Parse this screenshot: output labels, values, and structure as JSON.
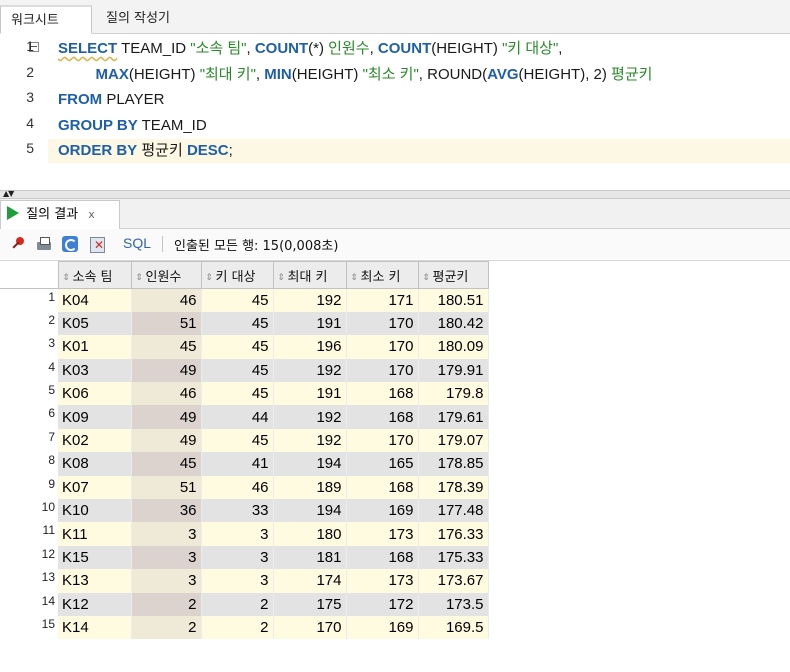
{
  "tabs": {
    "worksheet": "워크시트",
    "query_builder": "질의 작성기"
  },
  "editor": {
    "line_numbers": [
      "1",
      "2",
      "3",
      "4",
      "5"
    ],
    "lines": [
      [
        {
          "t": "SELECT",
          "c": "kw squig"
        },
        {
          "t": " TEAM_ID ",
          "c": ""
        },
        {
          "t": "\"소속 팀\"",
          "c": "str"
        },
        {
          "t": ", ",
          "c": ""
        },
        {
          "t": "COUNT",
          "c": "fn"
        },
        {
          "t": "(*) ",
          "c": ""
        },
        {
          "t": "인원수",
          "c": "str"
        },
        {
          "t": ", ",
          "c": ""
        },
        {
          "t": "COUNT",
          "c": "fn"
        },
        {
          "t": "(HEIGHT) ",
          "c": ""
        },
        {
          "t": "\"키 대상\"",
          "c": "str"
        },
        {
          "t": ",",
          "c": ""
        }
      ],
      [
        {
          "t": "         ",
          "c": ""
        },
        {
          "t": "MAX",
          "c": "fn"
        },
        {
          "t": "(HEIGHT) ",
          "c": ""
        },
        {
          "t": "\"최대 키\"",
          "c": "str"
        },
        {
          "t": ", ",
          "c": ""
        },
        {
          "t": "MIN",
          "c": "fn"
        },
        {
          "t": "(HEIGHT) ",
          "c": ""
        },
        {
          "t": "\"최소 키\"",
          "c": "str"
        },
        {
          "t": ", ROUND(",
          "c": ""
        },
        {
          "t": "AVG",
          "c": "fn"
        },
        {
          "t": "(HEIGHT), 2) ",
          "c": ""
        },
        {
          "t": "평균키",
          "c": "str"
        }
      ],
      [
        {
          "t": "FROM",
          "c": "kw"
        },
        {
          "t": " PLAYER",
          "c": ""
        }
      ],
      [
        {
          "t": "GROUP BY",
          "c": "kw"
        },
        {
          "t": " TEAM_ID",
          "c": ""
        }
      ],
      [
        {
          "t": "ORDER BY",
          "c": "kw"
        },
        {
          "t": " 평균키 ",
          "c": ""
        },
        {
          "t": "DESC",
          "c": "kw"
        },
        {
          "t": ";",
          "c": ""
        }
      ]
    ]
  },
  "results_tab": {
    "label": "질의 결과",
    "close": "x"
  },
  "toolbar": {
    "sql_label": "SQL",
    "status": "인출된 모든 행: 15(0,008초)"
  },
  "grid": {
    "columns": [
      "소속 팀",
      "인원수",
      "키 대상",
      "최대 키",
      "최소 키",
      "평균키"
    ],
    "rows": [
      [
        "K04",
        "46",
        "45",
        "192",
        "171",
        "180.51"
      ],
      [
        "K05",
        "51",
        "45",
        "191",
        "170",
        "180.42"
      ],
      [
        "K01",
        "45",
        "45",
        "196",
        "170",
        "180.09"
      ],
      [
        "K03",
        "49",
        "45",
        "192",
        "170",
        "179.91"
      ],
      [
        "K06",
        "46",
        "45",
        "191",
        "168",
        "179.8"
      ],
      [
        "K09",
        "49",
        "44",
        "192",
        "168",
        "179.61"
      ],
      [
        "K02",
        "49",
        "45",
        "192",
        "170",
        "179.07"
      ],
      [
        "K08",
        "45",
        "41",
        "194",
        "165",
        "178.85"
      ],
      [
        "K07",
        "51",
        "46",
        "189",
        "168",
        "178.39"
      ],
      [
        "K10",
        "36",
        "33",
        "194",
        "169",
        "177.48"
      ],
      [
        "K11",
        "3",
        "3",
        "180",
        "173",
        "176.33"
      ],
      [
        "K15",
        "3",
        "3",
        "181",
        "168",
        "175.33"
      ],
      [
        "K13",
        "3",
        "3",
        "174",
        "173",
        "173.67"
      ],
      [
        "K12",
        "2",
        "2",
        "175",
        "172",
        "173.5"
      ],
      [
        "K14",
        "2",
        "2",
        "170",
        "169",
        "169.5"
      ]
    ]
  },
  "icons": {
    "pin": "pin-icon",
    "print": "print-icon",
    "refresh": "refresh-icon",
    "cancel": "cancel-query-icon",
    "run": "run-result-icon",
    "sort": "sort-icon",
    "fold": "fold-collapse-icon"
  }
}
